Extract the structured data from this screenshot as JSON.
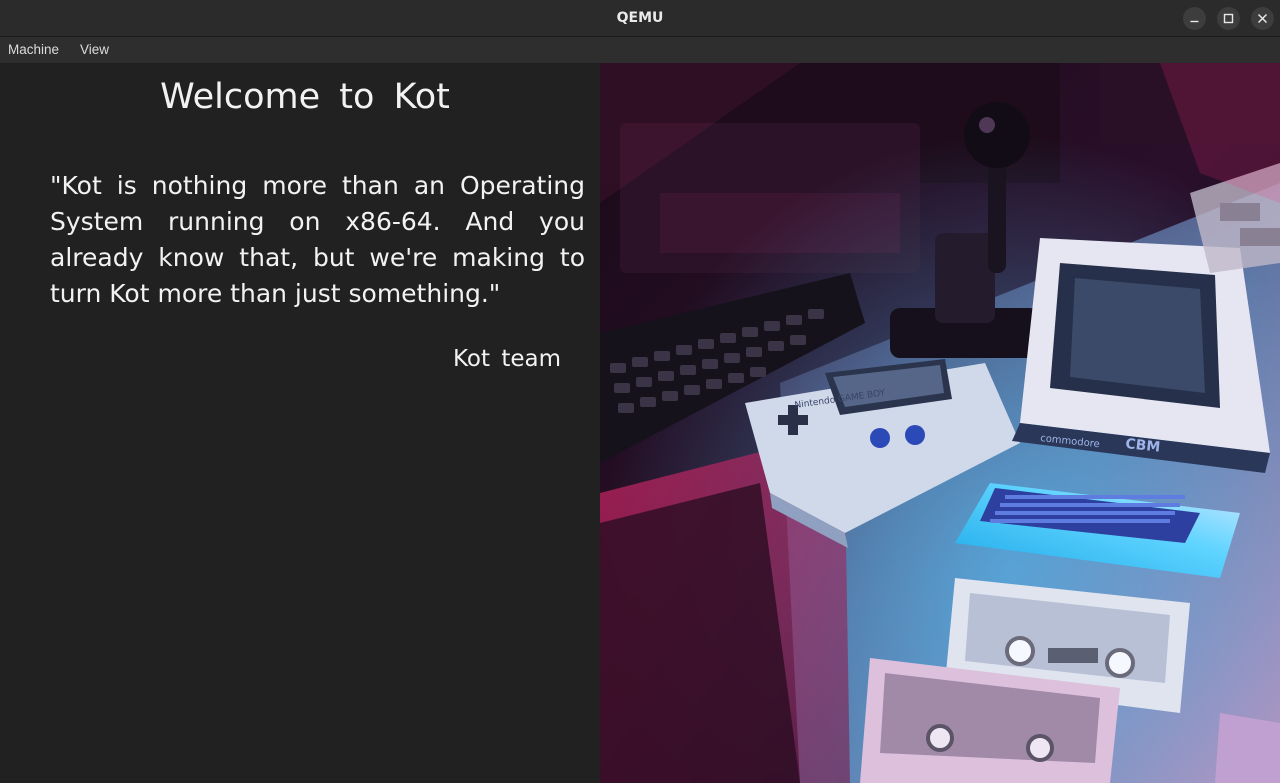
{
  "window": {
    "title": "QEMU",
    "controls": [
      "minimize-icon",
      "maximize-icon",
      "close-icon"
    ]
  },
  "menubar": {
    "items": [
      "Machine",
      "View"
    ]
  },
  "guest": {
    "heading": "Welcome to Kot",
    "quote": "\"Kot is nothing more than an Operating System running on x86-64. And you already know that, but we're making to turn Kot more than just something.\"",
    "signature": "Kot team",
    "image": {
      "printed_labels": [
        "Nintendo GAME BOY",
        "commodore",
        "CBM"
      ]
    }
  },
  "colors": {
    "background": "#212121",
    "titlebar": "#2b2b2b",
    "text": "#f2f2f2",
    "accent_pink": "#ff2d7a",
    "accent_cyan": "#2fd0ff"
  }
}
